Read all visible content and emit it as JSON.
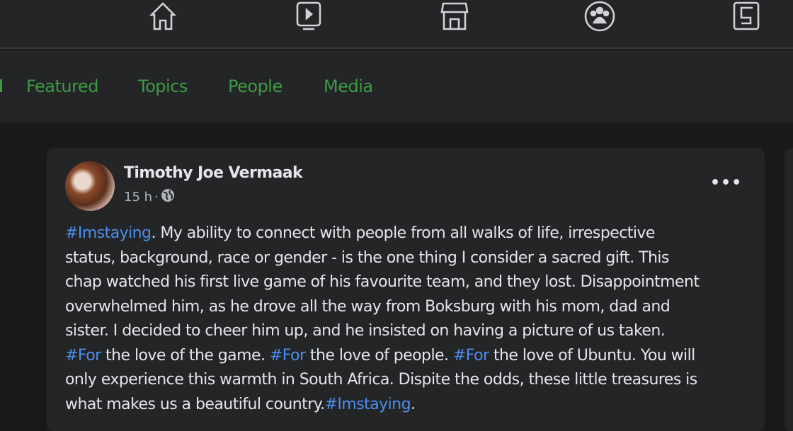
{
  "nav": {
    "icons": [
      "home-icon",
      "watch-icon",
      "marketplace-icon",
      "groups-icon",
      "gaming-icon"
    ]
  },
  "tabs": [
    "Featured",
    "Topics",
    "People",
    "Media"
  ],
  "post": {
    "author": "Timothy Joe Vermaak",
    "time": "15 h",
    "separator": "·",
    "privacy_icon": "globe-icon",
    "more": "•••",
    "lines": [
      [
        {
          "t": "#Imstaying",
          "tag": true
        },
        {
          "t": ". My ability to connect with people from all walks of life, irrespective"
        }
      ],
      [
        {
          "t": "status, background, race or gender - is the one thing I consider a sacred gift. This"
        }
      ],
      [
        {
          "t": "chap watched his first live game of his favourite team, and they lost. Disappointment"
        }
      ],
      [
        {
          "t": "overwhelmed him, as he drove all the way from Boksburg with his mom, dad and"
        }
      ],
      [
        {
          "t": "sister. I decided to cheer him up, and he insisted on having a picture of us taken."
        }
      ],
      [
        {
          "t": "#For",
          "tag": true
        },
        {
          "t": " the love of the game. "
        },
        {
          "t": "#For",
          "tag": true
        },
        {
          "t": " the love of people. "
        },
        {
          "t": "#For",
          "tag": true
        },
        {
          "t": " the love of Ubuntu. You will"
        }
      ],
      [
        {
          "t": "only experience this warmth in South Africa. Dispite the odds, these little treasures is"
        }
      ],
      [
        {
          "t": "what makes us a beautiful country."
        },
        {
          "t": "#Imstaying",
          "tag": true
        },
        {
          "t": "."
        }
      ]
    ]
  },
  "colors": {
    "tab_green": "#3d9a45",
    "hashtag_blue": "#4b8ef0",
    "background": "#18191a",
    "surface": "#242526"
  }
}
